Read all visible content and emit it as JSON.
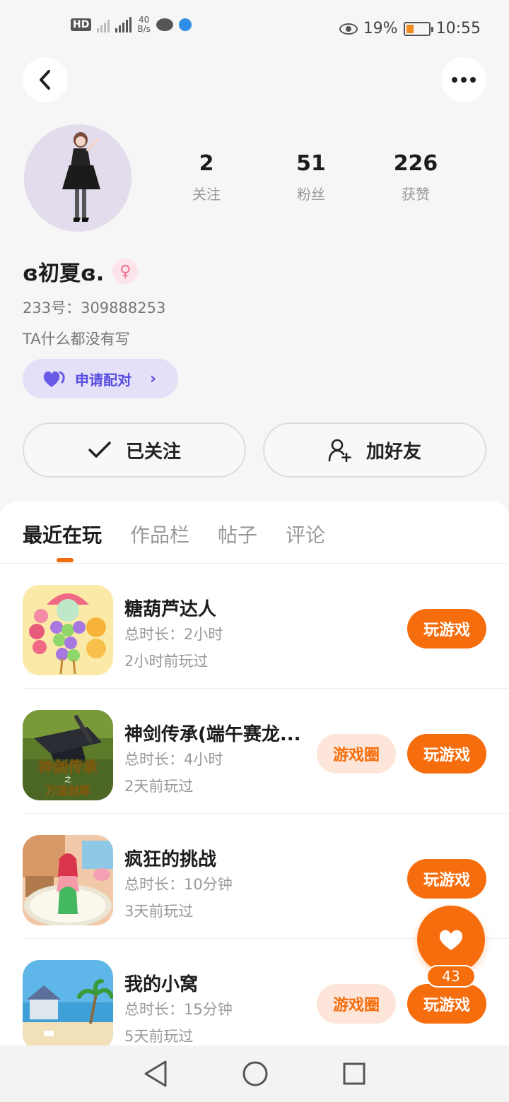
{
  "status_bar": {
    "hd": "HD",
    "net_speed_value": "40",
    "net_speed_unit": "B/s",
    "battery": "19%",
    "time": "10:55"
  },
  "profile": {
    "stats": [
      {
        "num": "2",
        "label": "关注"
      },
      {
        "num": "51",
        "label": "粉丝"
      },
      {
        "num": "226",
        "label": "获赞"
      }
    ],
    "nickname": "ɞ初夏ɞ.",
    "uid": "233号：309888253",
    "bio": "TA什么都没有写",
    "pair_label": "申请配对",
    "follow_label": "已关注",
    "add_friend_label": "加好友"
  },
  "tabs": [
    "最近在玩",
    "作品栏",
    "帖子",
    "评论"
  ],
  "games": [
    {
      "name": "糖葫芦达人",
      "duration": "总时长：2小时",
      "last_played": "2小时前玩过",
      "circle": "",
      "play": "玩游戏"
    },
    {
      "name": "神剑传承(端午赛龙...",
      "duration": "总时长：4小时",
      "last_played": "2天前玩过",
      "circle": "游戏圈",
      "play": "玩游戏"
    },
    {
      "name": "疯狂的挑战",
      "duration": "总时长：10分钟",
      "last_played": "3天前玩过",
      "circle": "",
      "play": "玩游戏"
    },
    {
      "name": "我的小窝",
      "duration": "总时长：15分钟",
      "last_played": "5天前玩过",
      "circle": "游戏圈",
      "play": "玩游戏"
    }
  ],
  "icon_texts": {
    "game2_line1": "神剑传承",
    "game2_line2": "万道剑尊"
  },
  "fab": {
    "count": "43"
  },
  "colors": {
    "accent": "#f56d0d",
    "pair_bg": "#e3e0f8",
    "pair_text": "#5a4ee0"
  }
}
